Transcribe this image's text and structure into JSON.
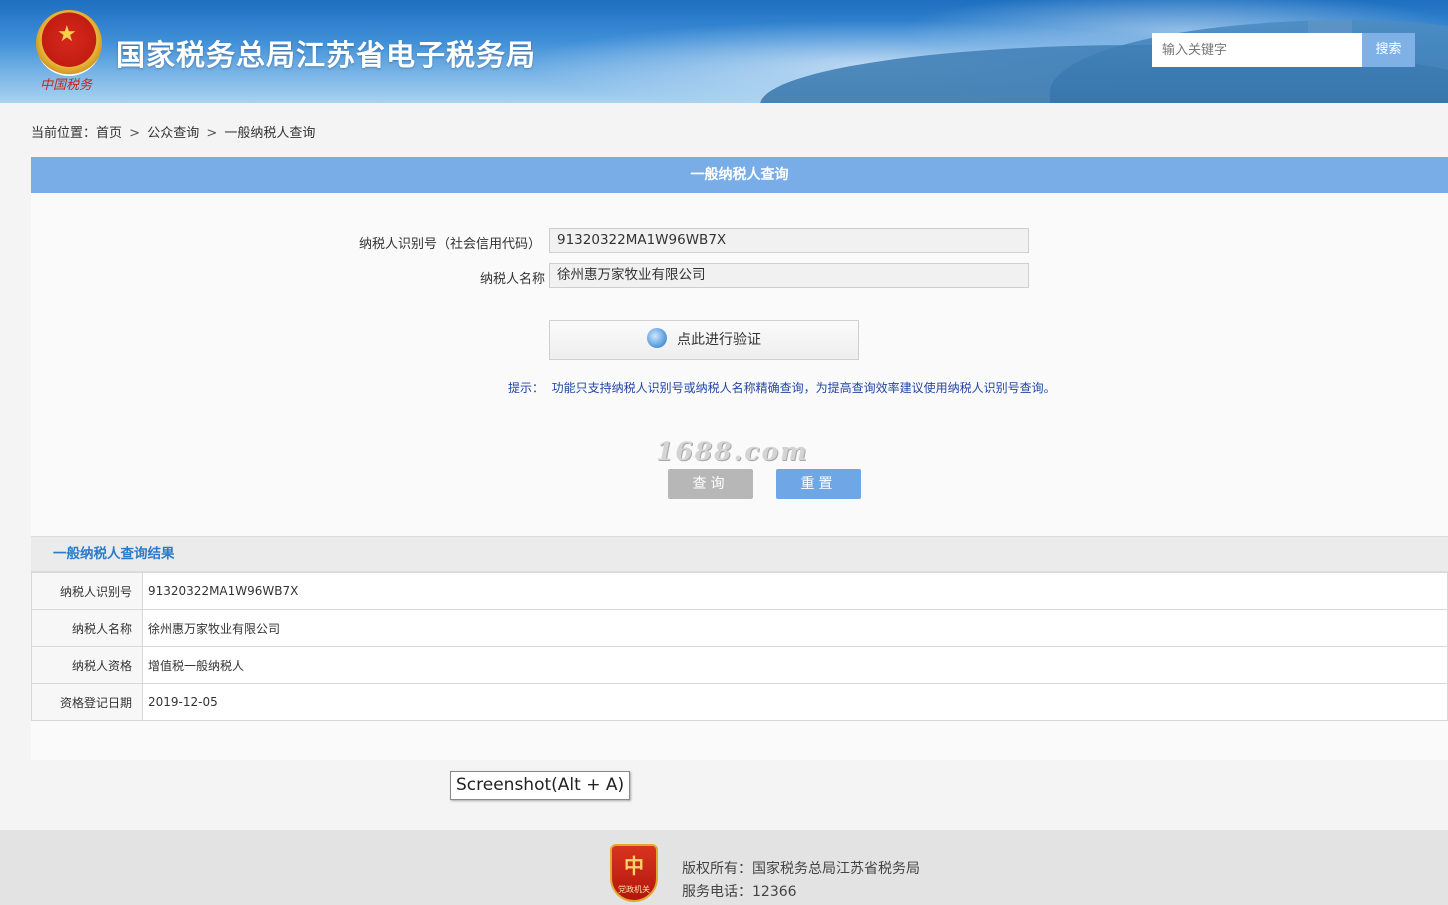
{
  "header": {
    "site_title": "国家税务总局江苏省电子税务局",
    "emblem_caption": "中国税务",
    "search_placeholder": "输入关键字",
    "search_button": "搜索"
  },
  "breadcrumb": {
    "prefix": "当前位置：",
    "items": [
      "首页",
      "公众查询",
      "一般纳税人查询"
    ],
    "separator": ">"
  },
  "query_panel": {
    "title": "一般纳税人查询",
    "taxpayer_id_label": "纳税人识别号（社会信用代码）",
    "taxpayer_id_value": "91320322MA1W96WB7X",
    "taxpayer_name_label": "纳税人名称",
    "taxpayer_name_value": "徐州惠万家牧业有限公司",
    "verify_button": "点此进行验证",
    "tip_label": "提示：",
    "tip_text": "功能只支持纳税人识别号或纳税人名称精确查询，为提高查询效率建议使用纳税人识别号查询。",
    "query_button": "查询",
    "reset_button": "重置",
    "watermark": "1688.com"
  },
  "result": {
    "title": "一般纳税人查询结果",
    "rows": [
      {
        "label": "纳税人识别号",
        "value": "91320322MA1W96WB7X"
      },
      {
        "label": "纳税人名称",
        "value": "徐州惠万家牧业有限公司"
      },
      {
        "label": "纳税人资格",
        "value": "增值税一般纳税人"
      },
      {
        "label": "资格登记日期",
        "value": "2019-12-05"
      }
    ]
  },
  "overlay": {
    "screenshot_tooltip": "Screenshot(Alt + A)"
  },
  "footer": {
    "badge_text": "党政机关",
    "copyright": "版权所有：国家税务总局江苏省税务局",
    "phone": "服务电话：12366"
  },
  "colors": {
    "panel_header": "#78ade8",
    "reset_button": "#6ea6e6",
    "query_button": "#b7b7b7",
    "tip_text": "#2346a6",
    "result_title": "#2b7bc9"
  }
}
